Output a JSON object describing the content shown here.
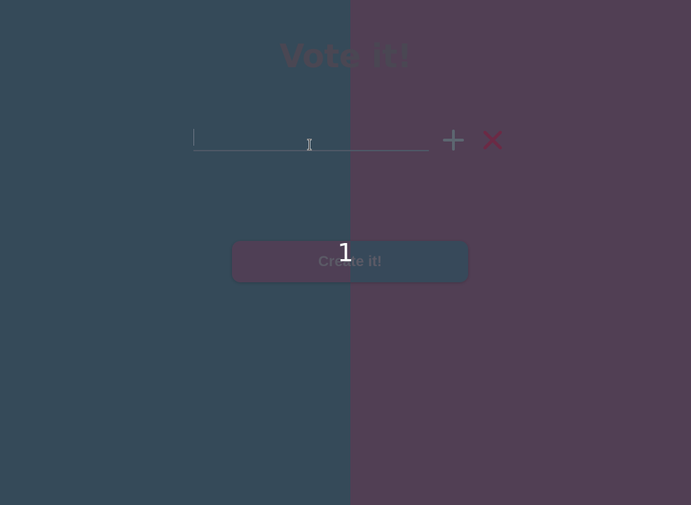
{
  "app": {
    "title": "Vote it!"
  },
  "option_input": {
    "value": "",
    "placeholder": ""
  },
  "buttons": {
    "add_icon": "plus-icon",
    "remove_icon": "close-icon",
    "create_label": "Create it!"
  },
  "overlay": {
    "count": "1"
  },
  "colors": {
    "left_panel": "#354a59",
    "right_panel": "#513f54",
    "title_text": "#4a4753",
    "add_icon": "#5c6670",
    "remove_icon": "#6b2a45",
    "count_text": "#ffffff"
  }
}
